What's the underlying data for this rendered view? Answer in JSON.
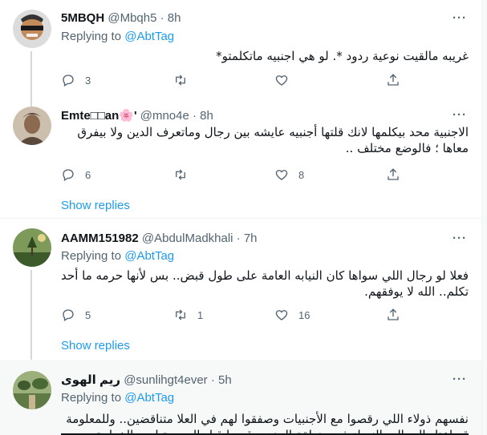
{
  "tweets": [
    {
      "name": "5MBQH",
      "handle": "@Mbqh5 · 8h",
      "replying_label": "Replying to",
      "replying_to": "@AbtTag",
      "text": "غريبه مالقيت نوعية ردود *. لو هي اجنبيه ماتكلمتو*",
      "reply_count": "3",
      "retweet_count": "",
      "like_count": ""
    },
    {
      "name": "Emte□□an🌸'",
      "handle": "@mno4e · 8h",
      "text": "الاجنبية محد بيكلمها لانك قلتها أجنبيه عايشه بين رجال وماتعرف الدين ولا بيفرق معاها ؛ فالوضع مختلف ..",
      "reply_count": "6",
      "retweet_count": "",
      "like_count": "8",
      "show_replies": "Show replies"
    },
    {
      "name": "AAMM151982",
      "handle": "@AbdulMadkhali · 7h",
      "replying_label": "Replying to",
      "replying_to": "@AbtTag",
      "text": "فعلا لو رجال اللي سواها كان النيابه العامة على طول قبض.. بس لأنها حرمه ما أحد تكلم.. الله لا يوفقهم.",
      "reply_count": "5",
      "retweet_count": "1",
      "like_count": "16",
      "show_replies": "Show replies"
    },
    {
      "name": "ريم الهوى",
      "handle": "@sunlihgt4ever · 5h",
      "replying_label": "Replying to",
      "replying_to": "@AbtTag",
      "text": "نفسهم ذولاء اللي رقصوا مع الأجنبيات وصفقوا لهم  في العلا متناقضين.. وللمعلومة قد اعتاد الرجال والنساء في منطقة الجنوب قديما قبل الصحوة لعب الخطوة مع"
    }
  ],
  "more_glyph": "···",
  "colors": {
    "accent": "#1d9bf0",
    "muted": "#536471",
    "text": "#0f1419"
  }
}
